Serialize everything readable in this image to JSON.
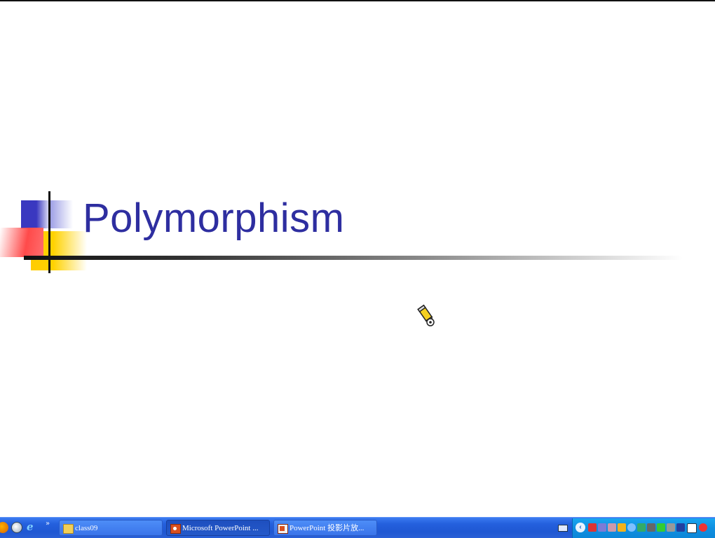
{
  "slide": {
    "title": "Polymorphism"
  },
  "taskbar": {
    "tasks": [
      {
        "label": "class09",
        "icon": "folder-icon",
        "active": false
      },
      {
        "label": "Microsoft PowerPoint ...",
        "icon": "powerpoint-icon",
        "active": true
      },
      {
        "label": "PowerPoint 投影片放...",
        "icon": "slideshow-icon",
        "active": false
      }
    ],
    "quick_launch_overflow": "»",
    "tray_expand": "‹"
  },
  "colors": {
    "title": "#2e2ea0",
    "taskbar": "#245edb",
    "tray": "#0f8fe0",
    "accent_blue": "#3a38c0",
    "accent_red": "#ff4a4a",
    "accent_yellow": "#ffcc00"
  }
}
